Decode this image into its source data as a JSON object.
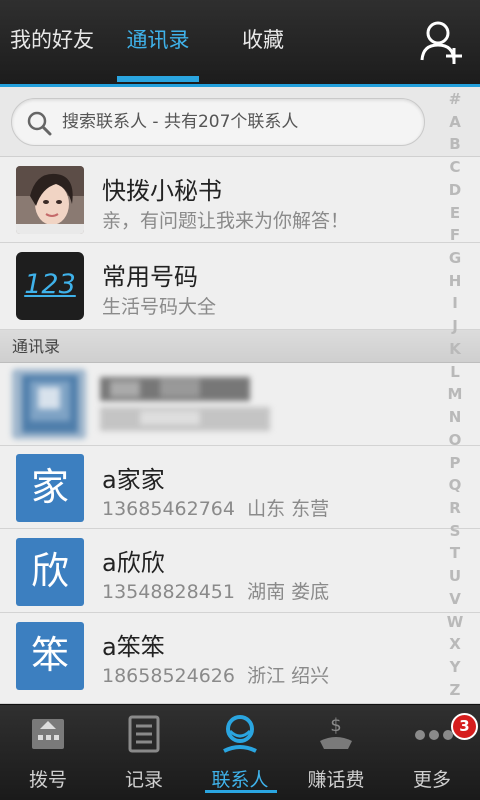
{
  "top_tabs": {
    "friends": "我的好友",
    "contacts": "通讯录",
    "favorites": "收藏"
  },
  "search": {
    "placeholder": "搜索联系人 - 共有207个联系人"
  },
  "alphabet_index": [
    "#",
    "A",
    "B",
    "C",
    "D",
    "E",
    "F",
    "G",
    "H",
    "I",
    "J",
    "K",
    "L",
    "M",
    "N",
    "O",
    "P",
    "Q",
    "R",
    "S",
    "T",
    "U",
    "V",
    "W",
    "X",
    "Y",
    "Z"
  ],
  "special_items": [
    {
      "title": "快拨小秘书",
      "subtitle": "亲，有问题让我来为你解答！"
    },
    {
      "title": "常用号码",
      "subtitle": "生活号码大全",
      "icon_text": "123"
    }
  ],
  "section_header": "通讯录",
  "contacts": [
    {
      "avatar_char": "家",
      "name": "a家家",
      "phone": "13685462764",
      "location": "山东 东营"
    },
    {
      "avatar_char": "欣",
      "name": "a欣欣",
      "phone": "13548828451",
      "location": "湖南 娄底"
    },
    {
      "avatar_char": "笨",
      "name": "a笨笨",
      "phone": "18658524626",
      "location": "浙江 绍兴"
    }
  ],
  "bottom_nav": {
    "dial": "拨号",
    "records": "记录",
    "contacts": "联系人",
    "earn": "赚话费",
    "more": "更多",
    "more_badge": "3"
  },
  "colors": {
    "accent": "#2aa5e0",
    "avatar_blue": "#3c7fc0",
    "badge_red": "#d61d1d"
  }
}
